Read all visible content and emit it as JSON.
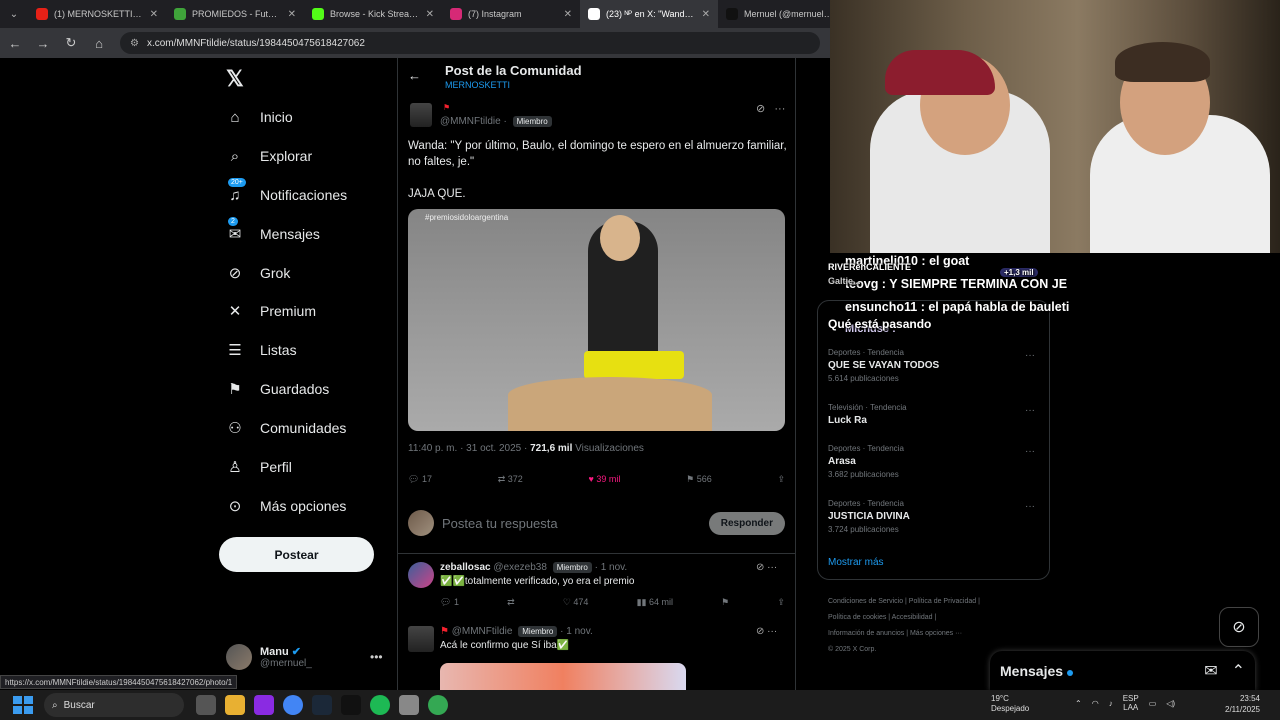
{
  "browser": {
    "tabs": [
      {
        "label": "(1) MERNOSKETTI: Cread",
        "color": "#e62117",
        "active": false
      },
      {
        "label": "PROMIEDOS - Futbol Arg",
        "color": "#3fa33a",
        "active": false
      },
      {
        "label": "Browse - Kick Streaming",
        "color": "#53fc18",
        "active": false
      },
      {
        "label": "(7) Instagram",
        "color": "#d62976",
        "active": false
      },
      {
        "label": "(23) ᴺᴾ en X: \"Wanda: \"Y p",
        "color": "#ffffff",
        "active": true
      },
      {
        "label": "Mernuel (@mernuel) | Ti",
        "color": "#111111",
        "active": false
      }
    ],
    "url": "x.com/MMNFtildie/status/1984450475618427062",
    "status_url": "https://x.com/MMNFtildie/status/1984450475618427062/photo/1"
  },
  "sidebar": {
    "items": [
      {
        "label": "Inicio",
        "icon": "home-icon",
        "glyph": "⌂"
      },
      {
        "label": "Explorar",
        "icon": "search-icon",
        "glyph": "⌕"
      },
      {
        "label": "Notificaciones",
        "icon": "bell-icon",
        "glyph": "♫",
        "badge": "20+"
      },
      {
        "label": "Mensajes",
        "icon": "mail-icon",
        "glyph": "✉",
        "badge": "2"
      },
      {
        "label": "Grok",
        "icon": "grok-icon",
        "glyph": "⊘"
      },
      {
        "label": "Premium",
        "icon": "x-icon",
        "glyph": "✕"
      },
      {
        "label": "Listas",
        "icon": "list-icon",
        "glyph": "☰"
      },
      {
        "label": "Guardados",
        "icon": "bookmark-icon",
        "glyph": "⚑"
      },
      {
        "label": "Comunidades",
        "icon": "people-icon",
        "glyph": "⚇"
      },
      {
        "label": "Perfil",
        "icon": "person-icon",
        "glyph": "♙"
      },
      {
        "label": "Más opciones",
        "icon": "more-circle-icon",
        "glyph": "⊙"
      }
    ],
    "post_button": "Postear",
    "user": {
      "name": "Manu",
      "handle": "@mernuel_"
    }
  },
  "post": {
    "header_title": "Post de la Comunidad",
    "header_subtitle": "MERNOSKETTI",
    "handle": "@MMNFtildie ·",
    "role": "Miembro",
    "text_line1": "Wanda: \"Y por último, Baulo, el domingo te espero en el almuerzo familiar, no faltes, je.\"",
    "text_line2": "JAJA QUE.",
    "media_tag": "#premiosidoloargentina",
    "time": "11:40 p. m. · 31 oct. 2025 ·",
    "views": "721,6 mil",
    "views_label": "Visualizaciones",
    "replies": "17",
    "reposts": "372",
    "likes": "39 mil",
    "bookmarks": "566"
  },
  "reply_box": {
    "placeholder": "Postea tu respuesta",
    "button": "Responder"
  },
  "comments": [
    {
      "name": "zeballosac",
      "handle": "@exezeb38",
      "role": "Miembro",
      "date": "· 1 nov.",
      "text": "✅✅totalmente verificado, yo era el premio",
      "replies": "1",
      "likes": "474",
      "views": "64 mil"
    },
    {
      "name": "",
      "handle": "@MMNFtildie",
      "role": "Miembro",
      "date": "· 1 nov.",
      "text": "Acá le confirmo que Sí iba✅"
    }
  ],
  "trends": {
    "title": "Qué está pasando",
    "items": [
      {
        "category": "Deportes · Tendencia",
        "name": "QUE SE VAYAN TODOS",
        "count": "5.614 publicaciones"
      },
      {
        "category": "Televisión · Tendencia",
        "name": "Luck Ra",
        "count": ""
      },
      {
        "category": "Deportes · Tendencia",
        "name": "Arasa",
        "count": "3.682 publicaciones"
      },
      {
        "category": "Deportes · Tendencia",
        "name": "JUSTICIA DIVINA",
        "count": "3.724 publicaciones"
      }
    ],
    "show_more": "Mostrar más"
  },
  "footer": {
    "links_line1": "Condiciones de Servicio  |  Política de Privacidad  |",
    "links_line2": "Política de cookies  |  Accesibilidad  |",
    "links_line3": "Información de anuncios  |  Más opciones ···",
    "copyright": "© 2025 X Corp."
  },
  "overlay_chat": [
    {
      "text": "martineli010 : el goat"
    },
    {
      "text": "RIVERenCALIENTE"
    },
    {
      "text": "+1,3 mil"
    },
    {
      "text": "teovg : Y SIEMPRE TERMINA CON JE"
    },
    {
      "text": "Galtie..."
    },
    {
      "text": "ensuncho11 : el papá habla de bauleti"
    },
    {
      "text": "Michdse :"
    }
  ],
  "messages_dock": {
    "title": "Mensajes"
  },
  "taskbar": {
    "search": "Buscar",
    "weather_temp": "19°C",
    "weather_desc": "Despejado",
    "lang": "ESP",
    "lang2": "LAA",
    "time": "23:54",
    "date": "2/11/2025"
  }
}
